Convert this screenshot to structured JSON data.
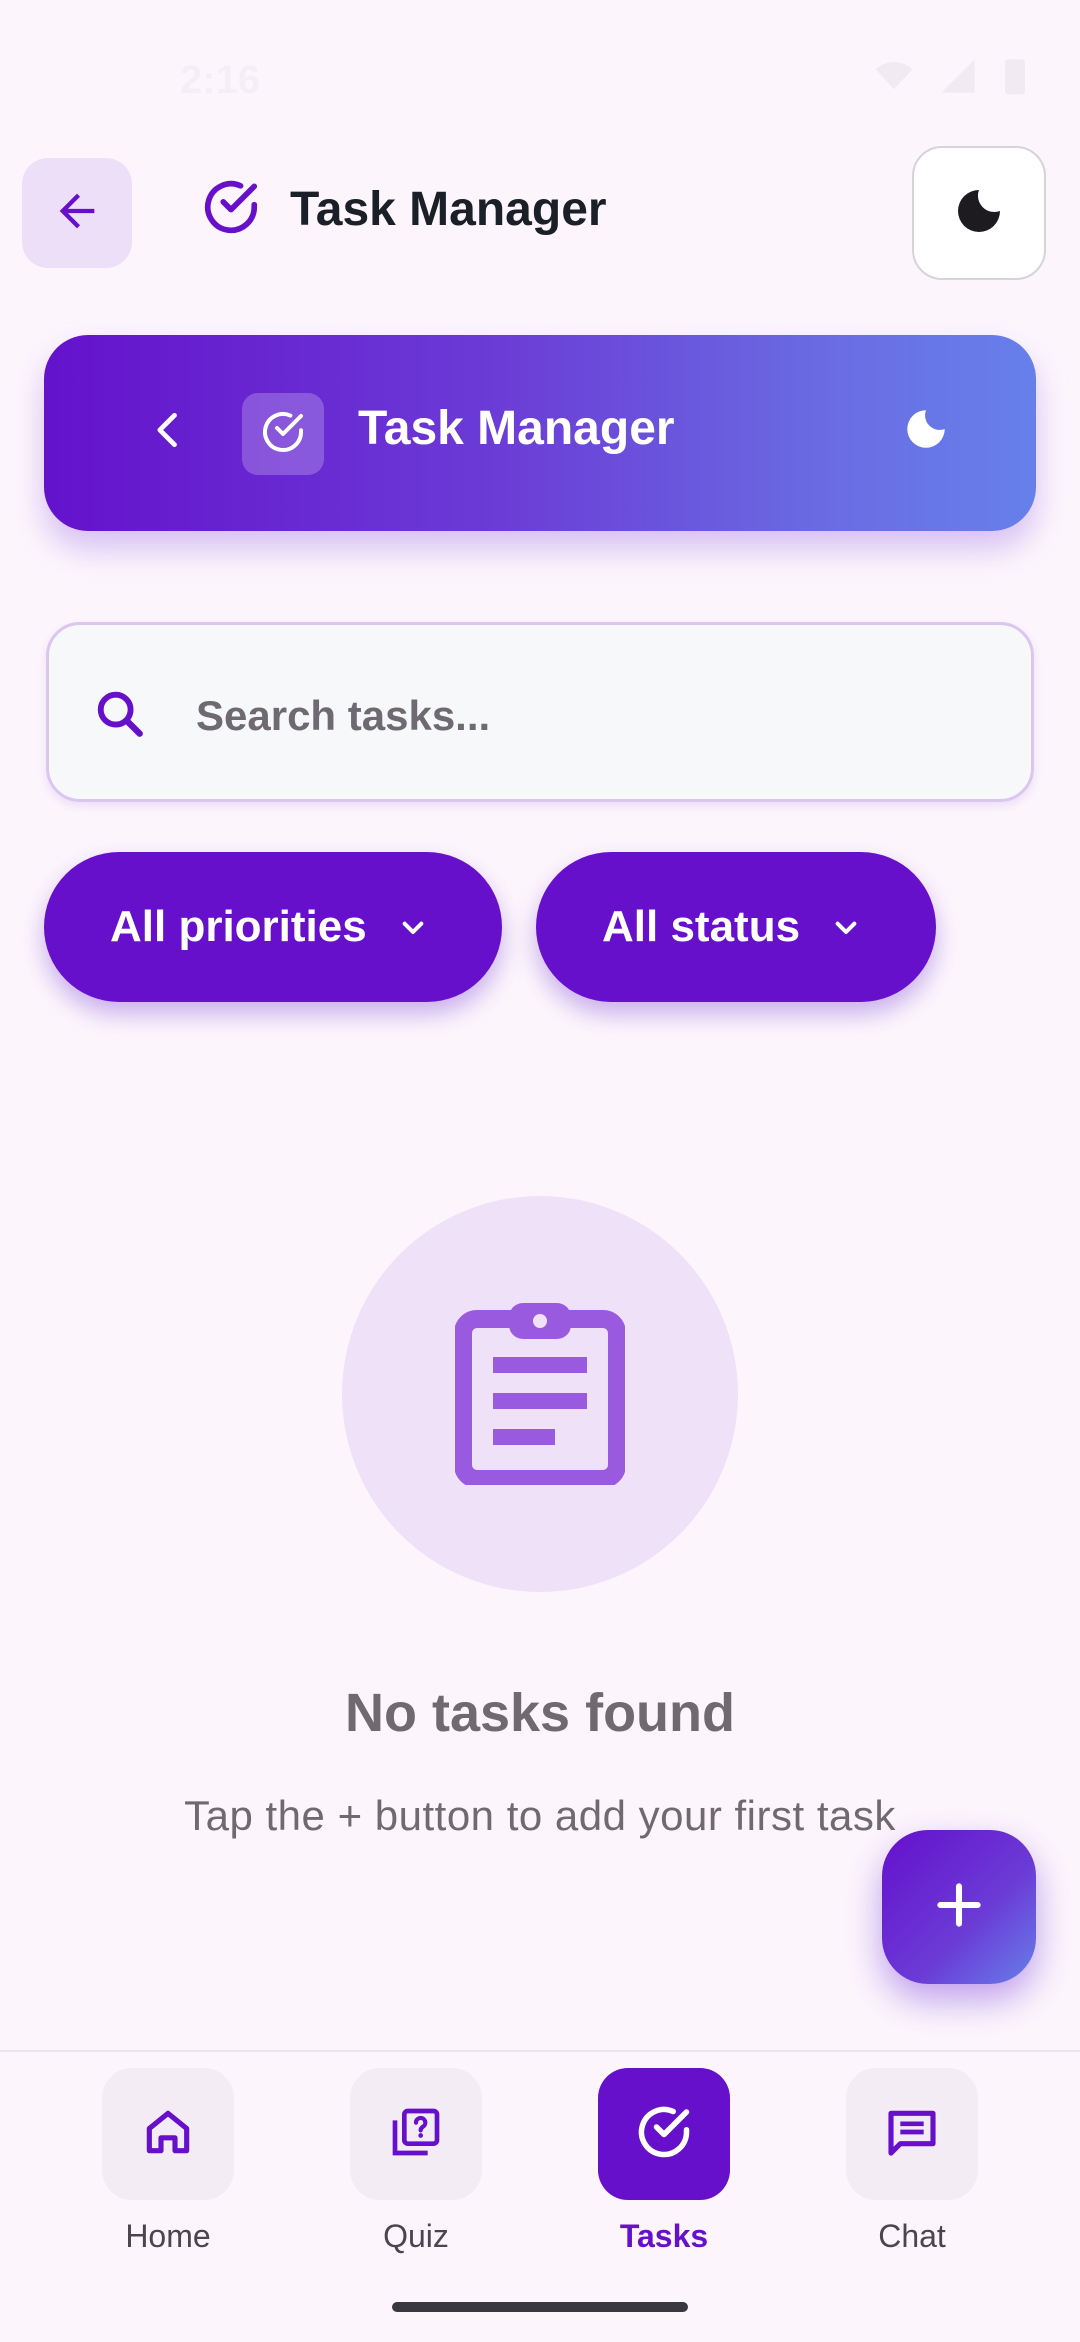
{
  "status_bar": {
    "time": "2:16"
  },
  "app_bar": {
    "title": "Task Manager"
  },
  "hero": {
    "title": "Task Manager"
  },
  "search": {
    "placeholder": "Search tasks...",
    "value": ""
  },
  "filters": {
    "priority_label": "All priorities",
    "status_label": "All status"
  },
  "empty_state": {
    "title": "No tasks found",
    "subtitle": "Tap the + button to add your first task"
  },
  "bottom_nav": {
    "items": [
      {
        "label": "Home",
        "icon": "home-icon"
      },
      {
        "label": "Quiz",
        "icon": "quiz-icon"
      },
      {
        "label": "Tasks",
        "icon": "check-circle-icon",
        "active": true
      },
      {
        "label": "Chat",
        "icon": "chat-icon"
      }
    ]
  },
  "colors": {
    "primary": "#6610CC",
    "gradient_end": "#6680EA",
    "background": "#FCF6FC",
    "muted_text": "#6E6A70"
  }
}
